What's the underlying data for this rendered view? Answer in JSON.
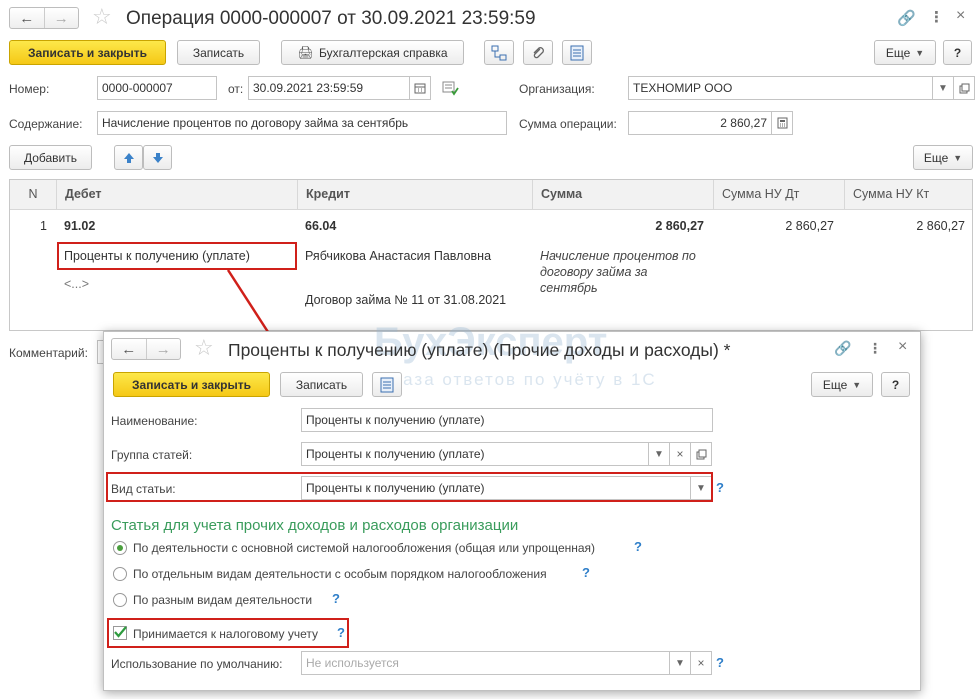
{
  "main": {
    "title": "Операция 0000-000007 от 30.09.2021 23:59:59",
    "toolbar": {
      "save_close": "Записать и закрыть",
      "save": "Записать",
      "report": "Бухгалтерская справка",
      "more": "Еще",
      "help": "?"
    },
    "fields": {
      "number_label": "Номер:",
      "number_value": "0000-000007",
      "date_label": "от:",
      "date_value": "30.09.2021 23:59:59",
      "org_label": "Организация:",
      "org_value": "ТЕХНОМИР ООО",
      "content_label": "Содержание:",
      "content_value": "Начисление процентов по договору займа за сентябрь",
      "sum_label": "Сумма операции:",
      "sum_value": "2 860,27",
      "comment_label": "Комментарий:"
    },
    "table_toolbar": {
      "add": "Добавить",
      "more": "Еще"
    },
    "table": {
      "headers": [
        "N",
        "Дебет",
        "Кредит",
        "Сумма",
        "Сумма НУ Дт",
        "Сумма НУ Кт"
      ],
      "row": {
        "n": "1",
        "debit_account": "91.02",
        "debit_sub1": "Проценты к получению (уплате)",
        "debit_sub2": "<...>",
        "credit_account": "66.04",
        "credit_sub1": "Рябчикова Анастасия Павловна",
        "credit_sub2": "Договор займа № 11 от 31.08.2021",
        "amount": "2 860,27",
        "amount_desc": "Начисление процентов по договору займа за сентябрь",
        "nu_dt": "2 860,27",
        "nu_kt": "2 860,27"
      }
    }
  },
  "dialog": {
    "title": "Проценты к получению (уплате) (Прочие доходы и расходы) *",
    "toolbar": {
      "save_close": "Записать и закрыть",
      "save": "Записать",
      "more": "Еще",
      "help": "?"
    },
    "name_label": "Наименование:",
    "name_value": "Проценты к получению (уплате)",
    "group_label": "Группа статей:",
    "group_value": "Проценты к получению (уплате)",
    "kind_label": "Вид статьи:",
    "kind_value": "Проценты к получению (уплате)",
    "section_title": "Статья для учета прочих доходов и расходов организации",
    "radios": [
      "По деятельности с основной системой налогообложения (общая или упрощенная)",
      "По отдельным видам деятельности с особым порядком налогообложения",
      "По разным видам деятельности"
    ],
    "checkbox_label": "Принимается к налоговому учету",
    "default_use_label": "Использование по умолчанию:",
    "default_use_placeholder": "Не используется",
    "help_mark": "?"
  },
  "watermark": {
    "brand": "БухЭксперт",
    "tagline": "База ответов по учёту в 1С"
  },
  "colors": {
    "accent_yellow": "#f5c816",
    "highlight_red": "#d0201a",
    "section_green": "#3a9c5c",
    "help_blue": "#2f7fc9"
  }
}
